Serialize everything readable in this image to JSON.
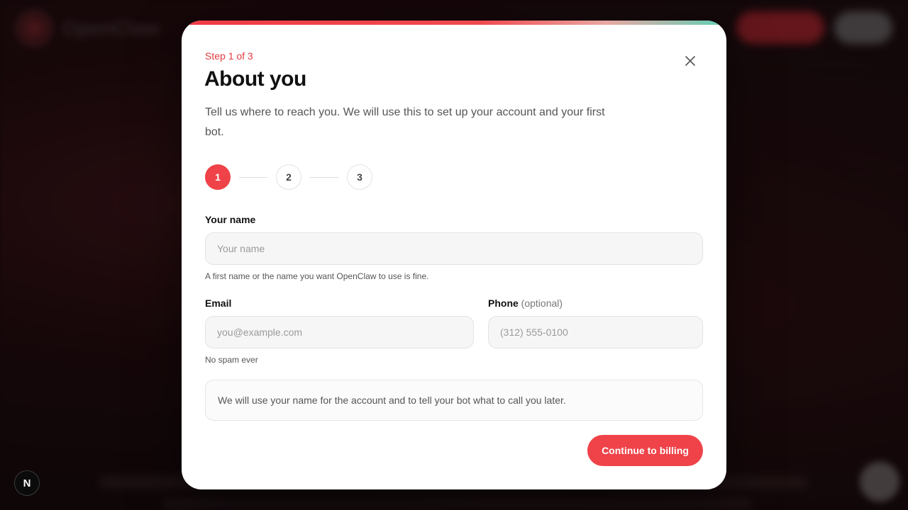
{
  "background": {
    "brand_blurred": "OpenClaw"
  },
  "modal": {
    "step_label": "Step 1 of 3",
    "title": "About you",
    "subtitle": "Tell us where to reach you. We will use this to set up your account and your first bot.",
    "stepper": {
      "steps": [
        "1",
        "2",
        "3"
      ],
      "active_index": 0
    },
    "name_field": {
      "label": "Your name",
      "placeholder": "Your name",
      "value": "",
      "help": "A first name or the name you want OpenClaw to use is fine."
    },
    "email_field": {
      "label": "Email",
      "placeholder": "you@example.com",
      "value": "",
      "help": "No spam ever"
    },
    "phone_field": {
      "label": "Phone",
      "optional_suffix": "(optional)",
      "placeholder": "(312) 555-0100",
      "value": ""
    },
    "note": "We will use your name for the account and to tell your bot what to call you later.",
    "continue_label": "Continue to billing"
  },
  "next_badge": "N",
  "colors": {
    "accent": "#ef4349",
    "accent_text": "#e23b42",
    "gradient_end": "#5fcfb4"
  }
}
